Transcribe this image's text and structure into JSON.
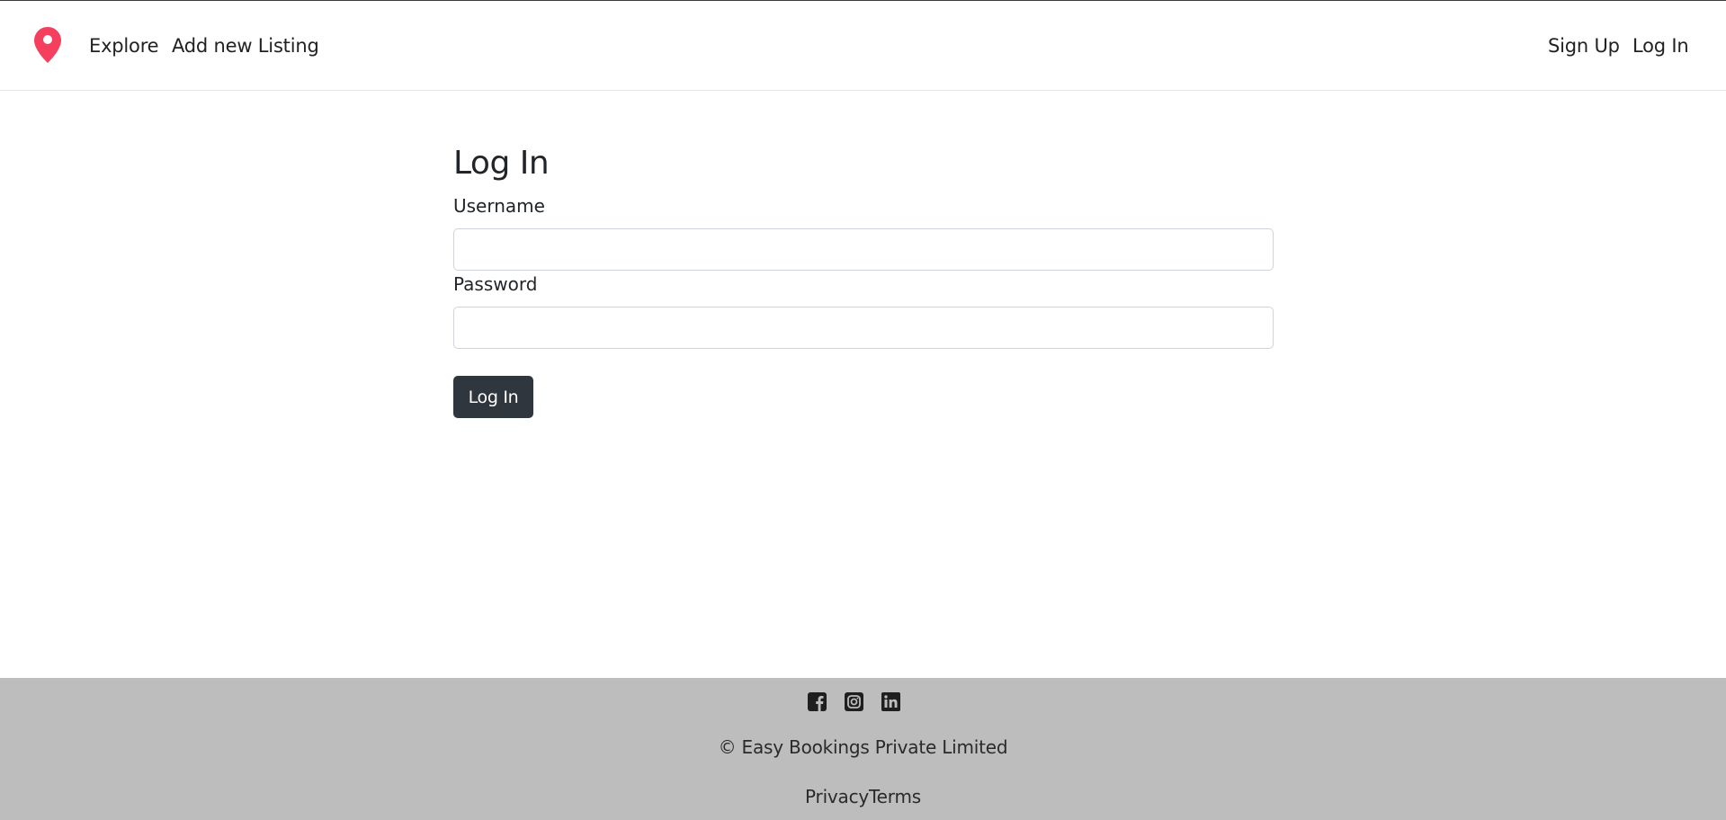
{
  "navbar": {
    "brand_icon": "map-pin-icon",
    "brand_color": "#f43f5e",
    "links_left": {
      "explore": "Explore",
      "add_listing": "Add new Listing"
    },
    "links_right": {
      "sign_up": "Sign Up",
      "log_in": "Log In"
    }
  },
  "login_form": {
    "title": "Log In",
    "username_label": "Username",
    "username_value": "",
    "password_label": "Password",
    "password_value": "",
    "submit_label": "Log In",
    "button_color": "#30363d"
  },
  "footer": {
    "background": "#bdbdbd",
    "social_icons": [
      "facebook-icon",
      "instagram-icon",
      "linkedin-icon"
    ],
    "copyright": "© Easy Bookings Private Limited",
    "privacy_label": "Privacy",
    "terms_label": "Terms"
  }
}
